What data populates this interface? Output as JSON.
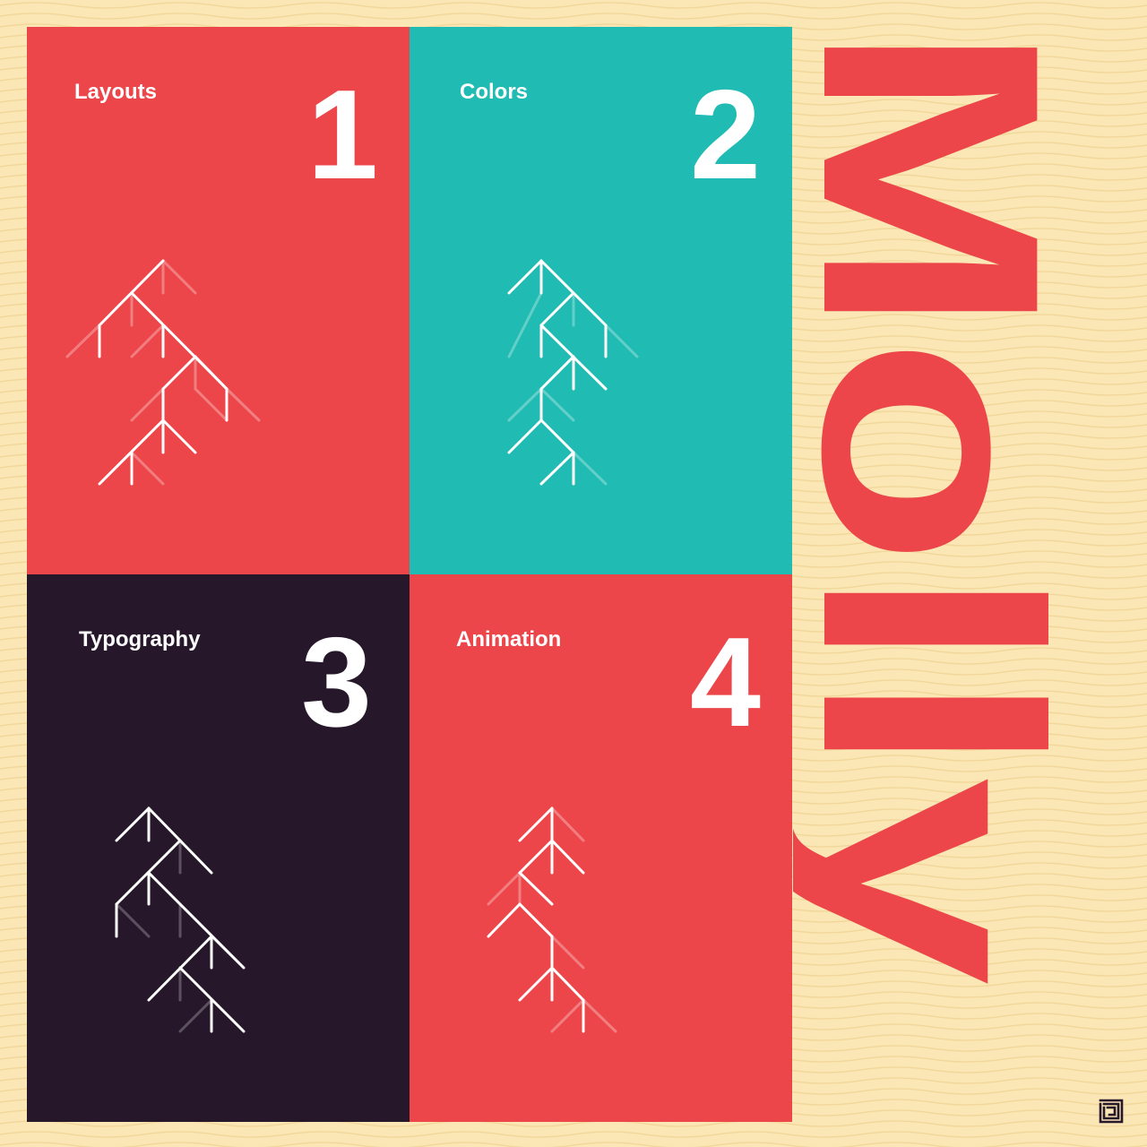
{
  "colors": {
    "background": "#FBE7B5",
    "coral": "#EC464A",
    "teal": "#20BBB2",
    "dark": "#26172A",
    "white": "#FFFFFF"
  },
  "panels": [
    {
      "label": "Layouts",
      "number": "1"
    },
    {
      "label": "Colors",
      "number": "2"
    },
    {
      "label": "Typography",
      "number": "3"
    },
    {
      "label": "Animation",
      "number": "4"
    }
  ],
  "brand": {
    "wordmark": "Molly"
  },
  "logo": {
    "icon": "maze-logo-icon"
  }
}
